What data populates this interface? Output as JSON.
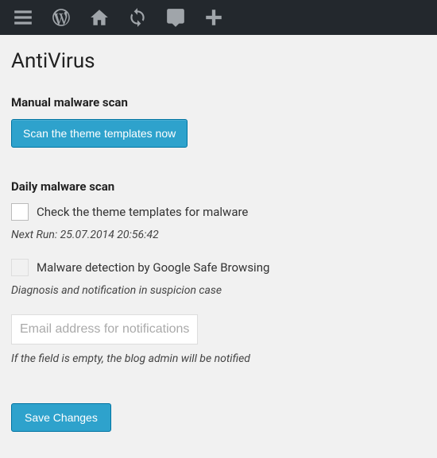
{
  "page": {
    "title": "AntiVirus"
  },
  "manual_scan": {
    "heading": "Manual malware scan",
    "button_label": "Scan the theme templates now"
  },
  "daily_scan": {
    "heading": "Daily malware scan",
    "check_templates": {
      "label": "Check the theme templates for malware",
      "checked": false
    },
    "next_run": "Next Run: 25.07.2014 20:56:42",
    "safe_browsing": {
      "label": "Malware detection by Google Safe Browsing",
      "checked": false
    },
    "diagnosis_helper": "Diagnosis and notification in suspicion case",
    "email": {
      "placeholder": "Email address for notifications",
      "value": ""
    },
    "email_helper": "If the field is empty, the blog admin will be notified"
  },
  "save_button": "Save Changes"
}
